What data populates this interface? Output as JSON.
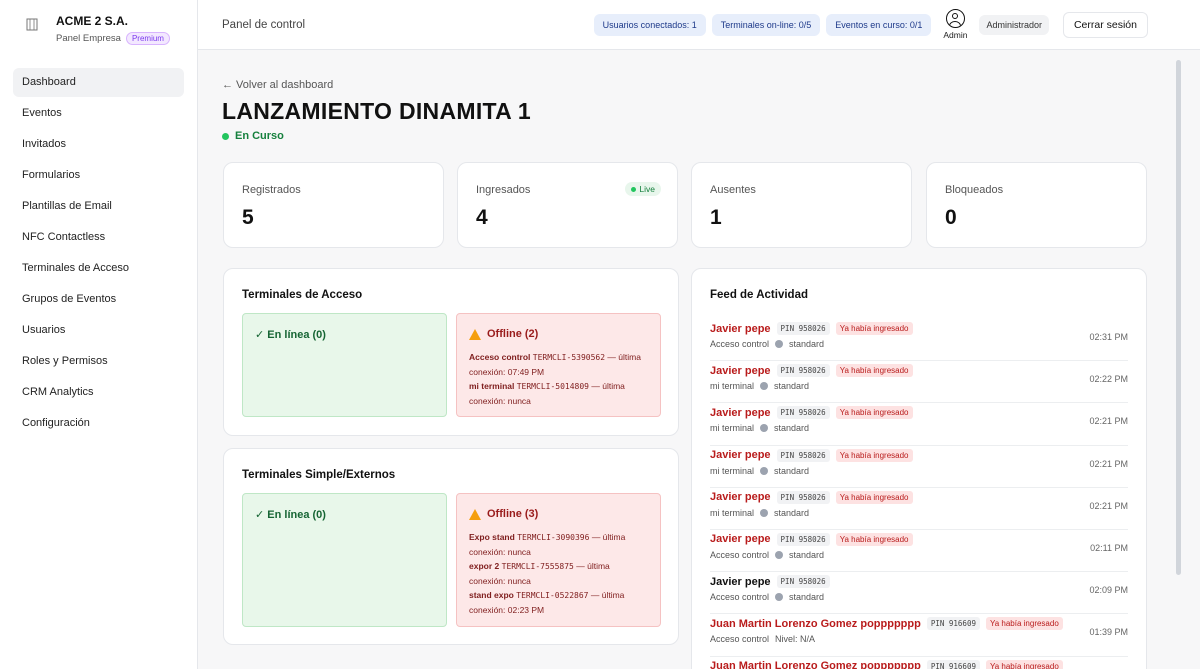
{
  "brand": {
    "name": "ACME 2 S.A.",
    "subtitle": "Panel Empresa",
    "badge": "Premium"
  },
  "sidebar": {
    "items": [
      {
        "label": "Dashboard",
        "active": true
      },
      {
        "label": "Eventos"
      },
      {
        "label": "Invitados"
      },
      {
        "label": "Formularios"
      },
      {
        "label": "Plantillas de Email"
      },
      {
        "label": "NFC Contactless"
      },
      {
        "label": "Terminales de Acceso"
      },
      {
        "label": "Grupos de Eventos"
      },
      {
        "label": "Usuarios"
      },
      {
        "label": "Roles y Permisos"
      },
      {
        "label": "CRM Analytics"
      },
      {
        "label": "Configuración"
      }
    ]
  },
  "header": {
    "title": "Panel de control",
    "pills": [
      "Usuarios conectados: 1",
      "Terminales on-line: 0/5",
      "Eventos en curso: 0/1"
    ],
    "admin_label": "Admin",
    "role": "Administrador",
    "logout_label": "Cerrar sesión"
  },
  "page": {
    "back_link": "← Volver al dashboard",
    "title": "LANZAMIENTO DINAMITA 1",
    "status": "En Curso"
  },
  "stats": [
    {
      "label": "Registrados",
      "value": "5"
    },
    {
      "label": "Ingresados",
      "value": "4",
      "badge": "Live"
    },
    {
      "label": "Ausentes",
      "value": "1"
    },
    {
      "label": "Bloqueados",
      "value": "0"
    }
  ],
  "terminals_access": {
    "title": "Terminales de Acceso",
    "online": "✓  En línea (0)",
    "offline_title": "Offline (2)",
    "offline_lines": [
      {
        "name": "Acceso control",
        "code": "TERMCLI-5390562",
        "rest": "— última conexión: 07:49 PM"
      },
      {
        "name": "mi terminal",
        "code": "TERMCLI-5014809",
        "rest": "— última conexión: nunca"
      }
    ]
  },
  "terminals_simple": {
    "title": "Terminales Simple/Externos",
    "online": "✓  En línea (0)",
    "offline_title": "Offline (3)",
    "offline_lines": [
      {
        "name": "Expo stand",
        "code": "TERMCLI-3090396",
        "rest": "— última conexión: nunca"
      },
      {
        "name": "expor 2",
        "code": "TERMCLI-7555875",
        "rest": "— última conexión: nunca"
      },
      {
        "name": "stand expo",
        "code": "TERMCLI-0522867",
        "rest": "— última conexión: 02:23 PM"
      }
    ]
  },
  "feed": {
    "title": "Feed de Actividad",
    "items": [
      {
        "name": "Javier pepe",
        "pin": "PIN 958026",
        "badge": "Ya había ingresado",
        "terminal": "Acceso control",
        "level": "standard",
        "time": "02:31 PM",
        "warn": true
      },
      {
        "name": "Javier pepe",
        "pin": "PIN 958026",
        "badge": "Ya había ingresado",
        "terminal": "mi terminal",
        "level": "standard",
        "time": "02:22 PM",
        "warn": true
      },
      {
        "name": "Javier pepe",
        "pin": "PIN 958026",
        "badge": "Ya había ingresado",
        "terminal": "mi terminal",
        "level": "standard",
        "time": "02:21 PM",
        "warn": true
      },
      {
        "name": "Javier pepe",
        "pin": "PIN 958026",
        "badge": "Ya había ingresado",
        "terminal": "mi terminal",
        "level": "standard",
        "time": "02:21 PM",
        "warn": true
      },
      {
        "name": "Javier pepe",
        "pin": "PIN 958026",
        "badge": "Ya había ingresado",
        "terminal": "mi terminal",
        "level": "standard",
        "time": "02:21 PM",
        "warn": true
      },
      {
        "name": "Javier pepe",
        "pin": "PIN 958026",
        "badge": "Ya había ingresado",
        "terminal": "Acceso control",
        "level": "standard",
        "time": "02:11 PM",
        "warn": true
      },
      {
        "name": "Javier pepe",
        "pin": "PIN 958026",
        "badge": "",
        "terminal": "Acceso control",
        "level": "standard",
        "time": "02:09 PM",
        "warn": false
      },
      {
        "name": "Juan Martin Lorenzo Gomez poppppppp",
        "pin": "PIN 916609",
        "badge": "Ya había ingresado",
        "terminal": "Acceso control",
        "level": "Nivel: N/A",
        "time": "01:39 PM",
        "warn": true
      },
      {
        "name": "Juan Martin Lorenzo Gomez poppppppp",
        "pin": "PIN 916609",
        "badge": "Ya había ingresado",
        "terminal": "",
        "level": "",
        "time": "",
        "warn": true
      }
    ]
  }
}
